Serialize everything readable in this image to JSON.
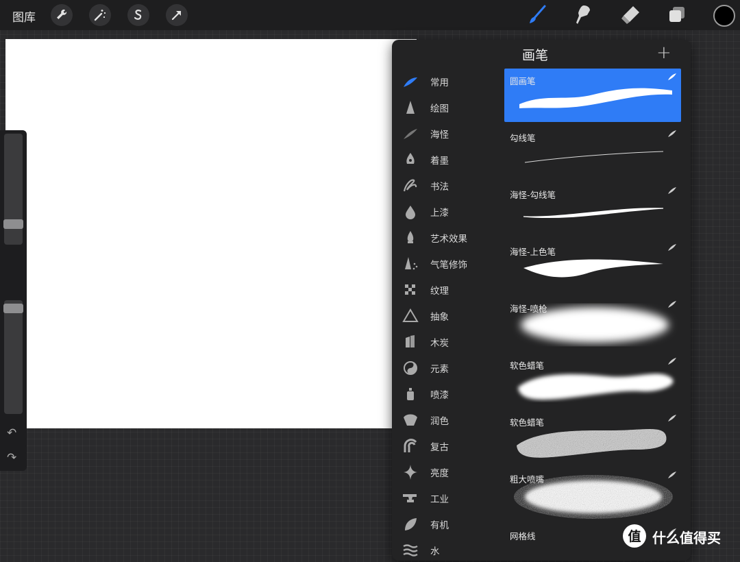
{
  "topbar": {
    "gallery_label": "图库",
    "left_tools": [
      "wrench-icon",
      "magic-wand-icon",
      "selection-icon",
      "transform-icon"
    ],
    "right_tools": [
      "brush-icon",
      "smudge-icon",
      "eraser-icon",
      "layers-icon"
    ],
    "active_tool": "brush-icon",
    "active_color": "#2f7cf6",
    "current_color": "#000000"
  },
  "panel": {
    "title": "画笔",
    "add_symbol": "+",
    "categories": [
      {
        "label": "常用",
        "icon": "feather-icon",
        "active": true
      },
      {
        "label": "绘图",
        "icon": "pencil-tip-icon"
      },
      {
        "label": "海怪",
        "icon": "brush-stroke-icon"
      },
      {
        "label": "着墨",
        "icon": "ink-nib-icon"
      },
      {
        "label": "书法",
        "icon": "calligraphy-icon"
      },
      {
        "label": "上漆",
        "icon": "paint-drop-icon"
      },
      {
        "label": "艺术效果",
        "icon": "art-drop-icon"
      },
      {
        "label": "气笔修饰",
        "icon": "airbrush-icon"
      },
      {
        "label": "纹理",
        "icon": "texture-icon"
      },
      {
        "label": "抽象",
        "icon": "triangle-icon"
      },
      {
        "label": "木炭",
        "icon": "charcoal-icon"
      },
      {
        "label": "元素",
        "icon": "yin-yang-icon"
      },
      {
        "label": "喷漆",
        "icon": "spray-can-icon"
      },
      {
        "label": "润色",
        "icon": "shell-icon"
      },
      {
        "label": "复古",
        "icon": "retro-arch-icon"
      },
      {
        "label": "亮度",
        "icon": "sparkle-icon"
      },
      {
        "label": "工业",
        "icon": "anvil-icon"
      },
      {
        "label": "有机",
        "icon": "leaf-icon"
      },
      {
        "label": "水",
        "icon": "waves-icon"
      }
    ],
    "brushes": [
      {
        "name": "圆画笔",
        "selected": true
      },
      {
        "name": "勾线笔"
      },
      {
        "name": "海怪-勾线笔"
      },
      {
        "name": "海怪-上色笔"
      },
      {
        "name": "海怪-喷枪"
      },
      {
        "name": "软色蜡笔"
      },
      {
        "name": "软色蜡笔"
      },
      {
        "name": "粗大喷嘴"
      },
      {
        "name": "网格线"
      }
    ]
  },
  "watermark": {
    "text": "什么值得买",
    "logo": "值"
  }
}
